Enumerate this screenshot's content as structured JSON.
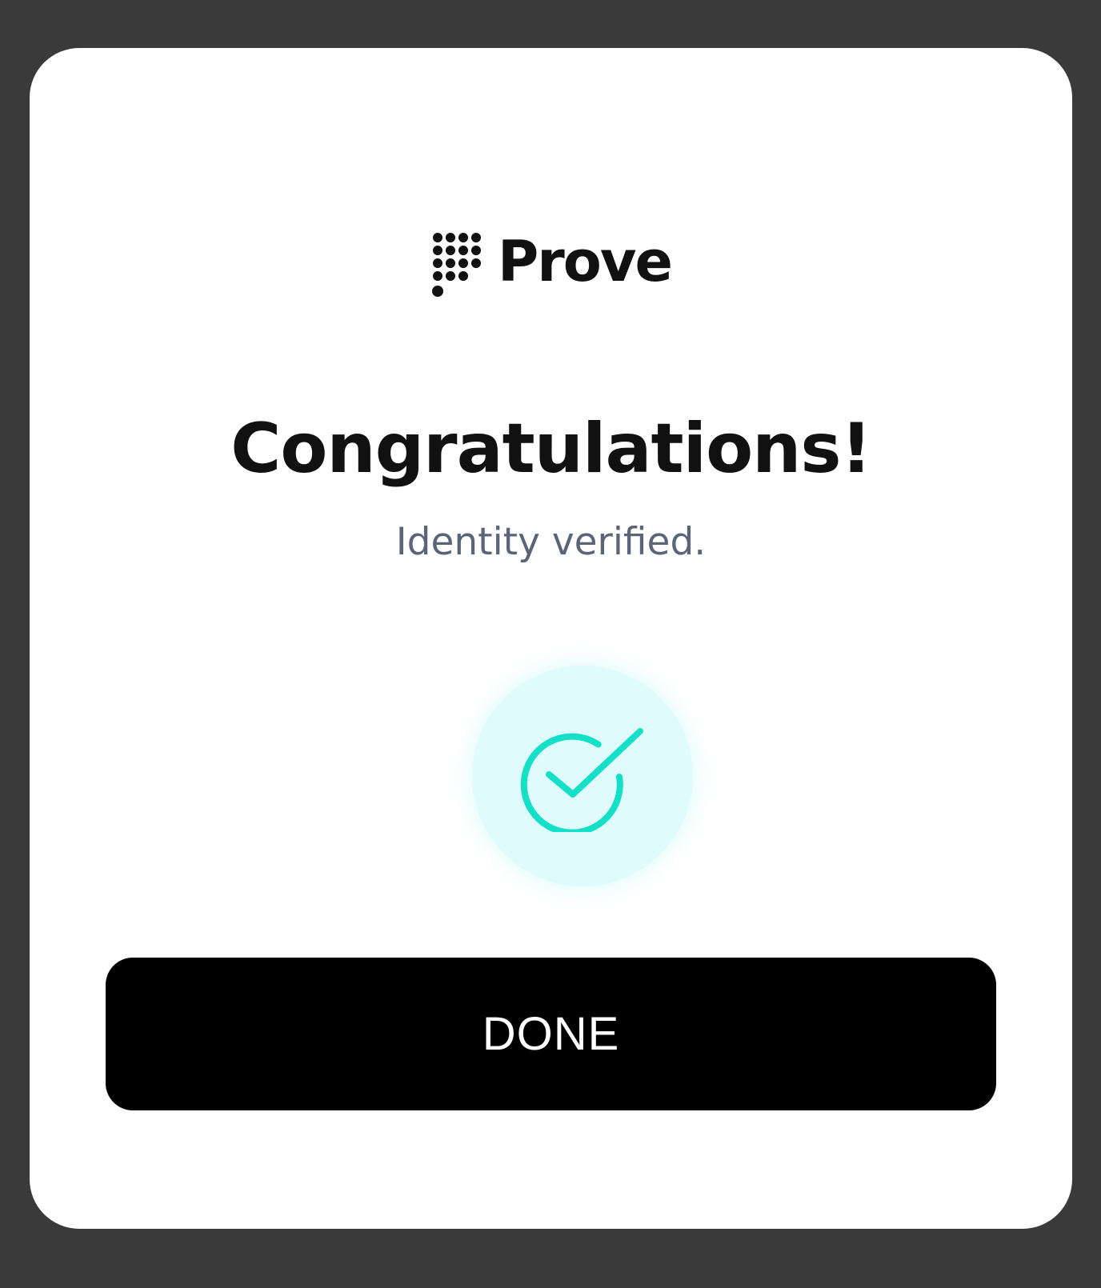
{
  "brand": {
    "name": "Prove",
    "logo_icon": "prove-dot-grid-logo"
  },
  "message": {
    "title": "Congratulations!",
    "subtitle": "Identity verified."
  },
  "status": {
    "icon": "check-circle-icon",
    "accent_color": "#14e0c8",
    "badge_color": "#e0fbfb"
  },
  "actions": {
    "done_label": "DONE"
  }
}
